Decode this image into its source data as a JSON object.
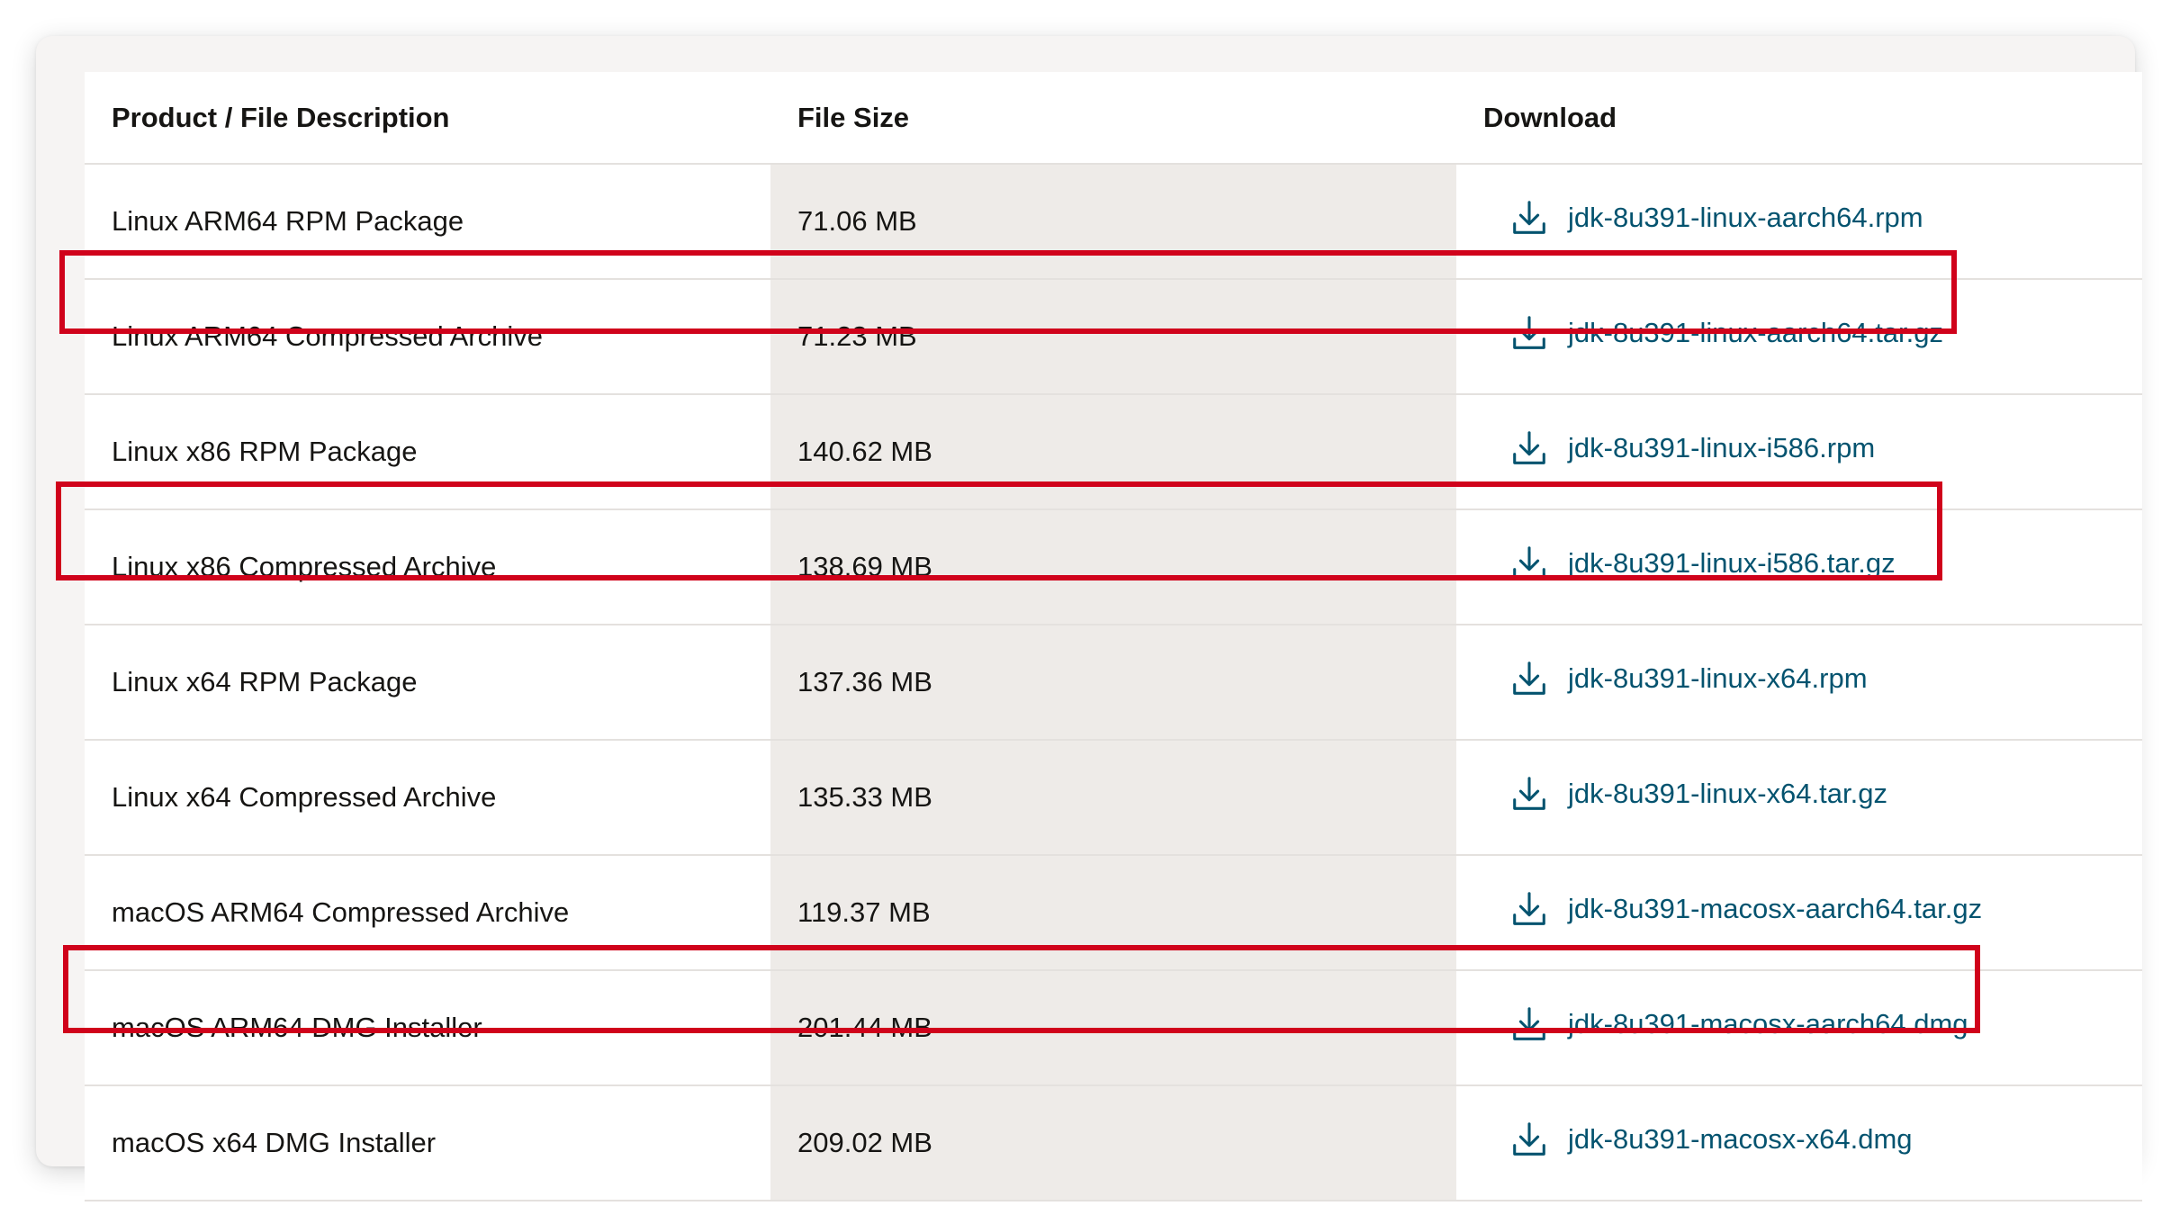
{
  "table": {
    "headers": {
      "description": "Product / File Description",
      "size": "File Size",
      "download": "Download"
    },
    "rows": [
      {
        "description": "Linux ARM64 RPM Package",
        "size": "71.06 MB",
        "file": "jdk-8u391-linux-aarch64.rpm",
        "highlighted": false
      },
      {
        "description": "Linux ARM64 Compressed Archive",
        "size": "71.23 MB",
        "file": "jdk-8u391-linux-aarch64.tar.gz",
        "highlighted": true
      },
      {
        "description": "Linux x86 RPM Package",
        "size": "140.62 MB",
        "file": "jdk-8u391-linux-i586.rpm",
        "highlighted": false
      },
      {
        "description": "Linux x86 Compressed Archive",
        "size": "138.69 MB",
        "file": "jdk-8u391-linux-i586.tar.gz",
        "highlighted": true
      },
      {
        "description": "Linux x64 RPM Package",
        "size": "137.36 MB",
        "file": "jdk-8u391-linux-x64.rpm",
        "highlighted": false
      },
      {
        "description": "Linux x64 Compressed Archive",
        "size": "135.33 MB",
        "file": "jdk-8u391-linux-x64.tar.gz",
        "highlighted": false
      },
      {
        "description": "macOS ARM64 Compressed Archive",
        "size": "119.37 MB",
        "file": "jdk-8u391-macosx-aarch64.tar.gz",
        "highlighted": false
      },
      {
        "description": "macOS ARM64 DMG Installer",
        "size": "201.44 MB",
        "file": "jdk-8u391-macosx-aarch64.dmg",
        "highlighted": true
      },
      {
        "description": "macOS x64 DMG Installer",
        "size": "209.02 MB",
        "file": "jdk-8u391-macosx-x64.dmg",
        "highlighted": false
      }
    ]
  },
  "icons": {
    "download": "download-icon"
  },
  "colors": {
    "link": "#04536f",
    "highlight_border": "#d0021b",
    "size_column_bg": "#eeebe8",
    "row_divider": "#e4e1de"
  }
}
